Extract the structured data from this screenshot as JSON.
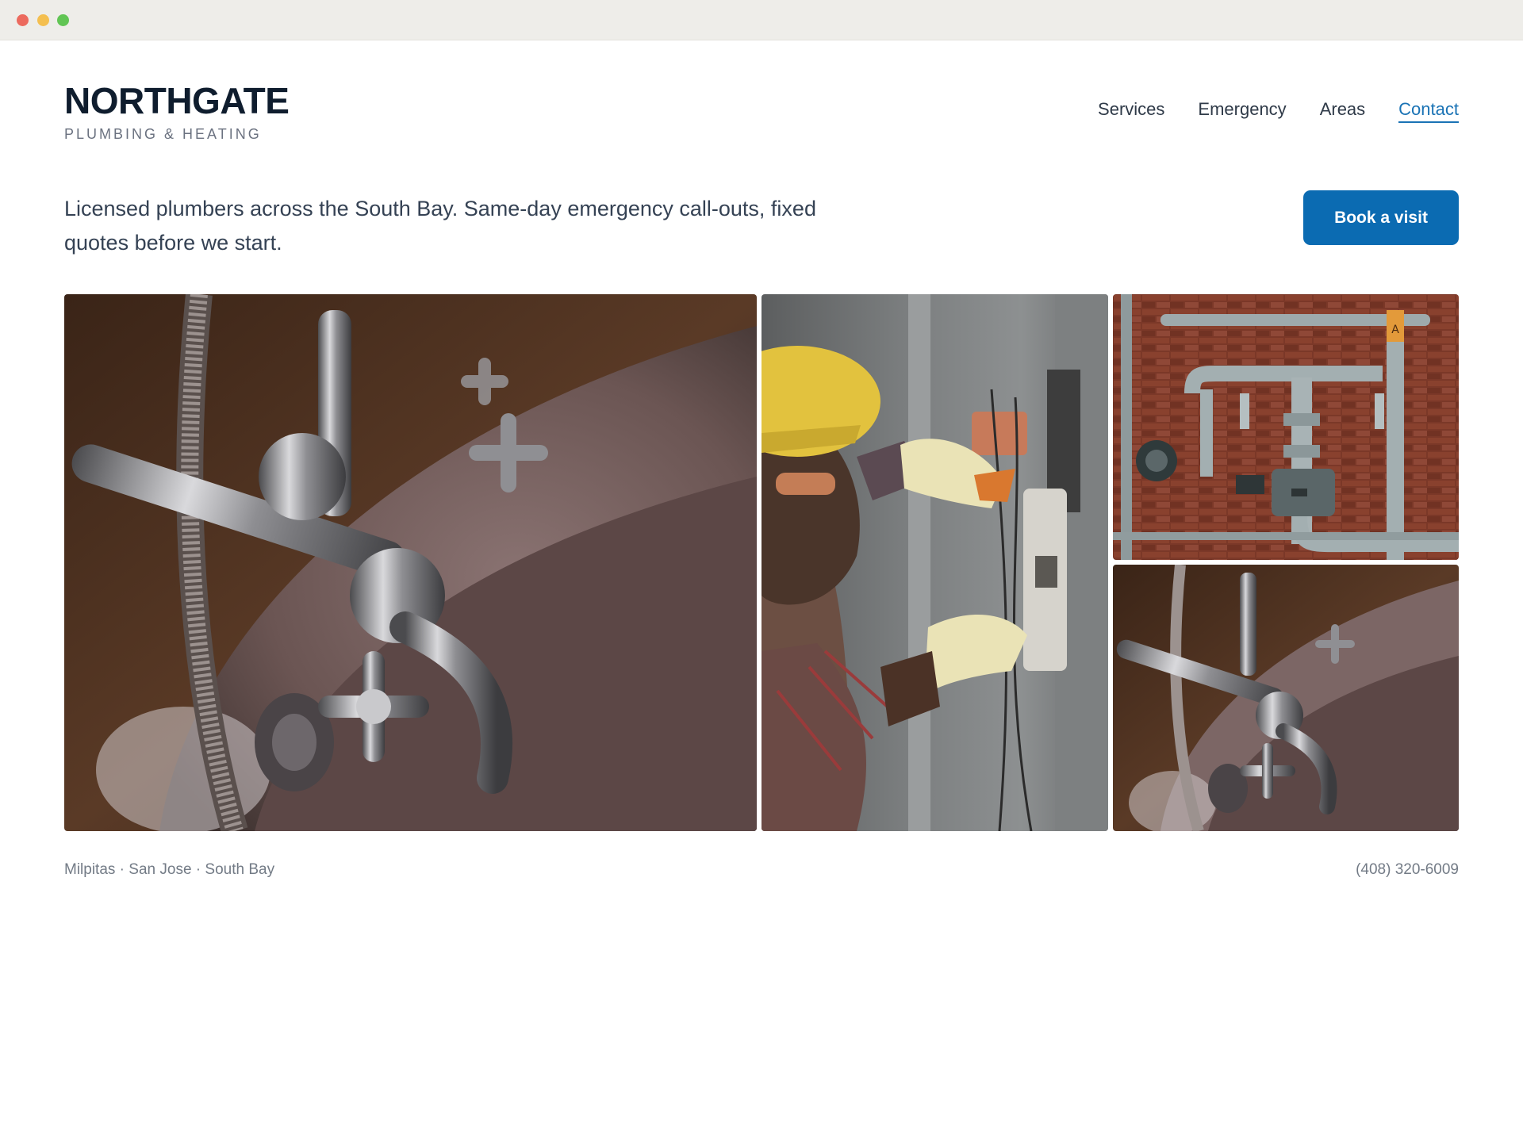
{
  "window": {
    "controls": [
      "close",
      "minimize",
      "maximize"
    ]
  },
  "brand": {
    "name": "NORTHGATE",
    "tagline": "PLUMBING & HEATING"
  },
  "nav": {
    "items": [
      {
        "label": "Services",
        "active": false
      },
      {
        "label": "Emergency",
        "active": false
      },
      {
        "label": "Areas",
        "active": false
      },
      {
        "label": "Contact",
        "active": true
      }
    ]
  },
  "hero": {
    "description": "Licensed plumbers across the South Bay. Same-day emergency call-outs, fixed quotes before we start.",
    "cta_label": "Book a visit"
  },
  "gallery": {
    "images": [
      {
        "subject": "chrome bathtub faucet and hand shower"
      },
      {
        "subject": "technician in yellow hard hat with gloves working on wall unit"
      },
      {
        "subject": "industrial pipes and valves on red brick wall"
      },
      {
        "subject": "chrome bathtub faucet and hand shower"
      }
    ]
  },
  "footer": {
    "areas": "Milpitas · San Jose · South Bay",
    "phone": "(408) 320-6009"
  },
  "colors": {
    "accent": "#0b6bb2",
    "link_active": "#1a73b5",
    "brand_text": "#0f1d2e"
  }
}
